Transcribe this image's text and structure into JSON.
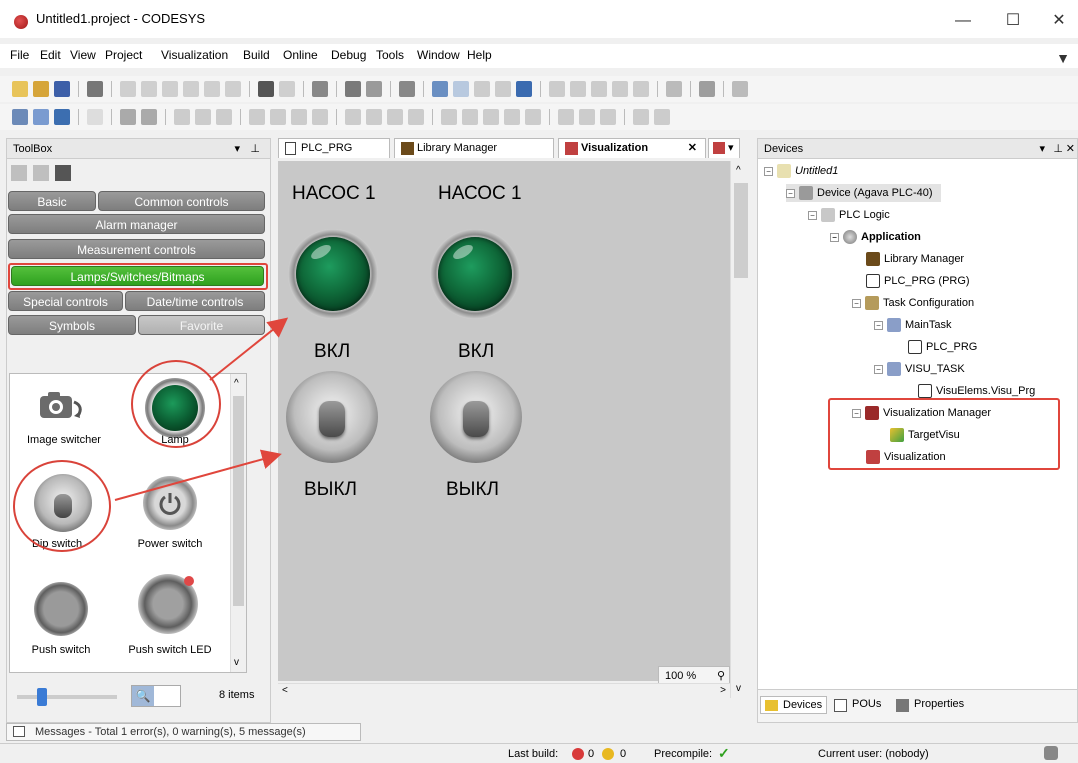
{
  "window": {
    "title": "Untitled1.project - CODESYS",
    "minimize": "—",
    "maximize": "☐",
    "close": "✕"
  },
  "menu": [
    "File",
    "Edit",
    "View",
    "Project",
    "Visualization",
    "Build",
    "Online",
    "Debug",
    "Tools",
    "Window",
    "Help"
  ],
  "toolbox": {
    "title": "ToolBox",
    "categories": {
      "basic": "Basic",
      "common": "Common controls",
      "alarm": "Alarm manager",
      "measurement": "Measurement controls",
      "lamps": "Lamps/Switches/Bitmaps",
      "special": "Special controls",
      "datetime": "Date/time controls",
      "symbols": "Symbols",
      "favorite": "Favorite"
    },
    "items": [
      "Image switcher",
      "Lamp",
      "Dip switch",
      "Power switch",
      "Push switch",
      "Push switch LED"
    ],
    "count": "8 items"
  },
  "editor": {
    "tabs": [
      "PLC_PRG",
      "Library Manager",
      "Visualization"
    ],
    "labels": {
      "pump1": "НАСОС 1",
      "pump2": "НАСОС 1",
      "on1": "ВКЛ",
      "on2": "ВКЛ",
      "off1": "ВЫКЛ",
      "off2": "ВЫКЛ"
    },
    "zoom": "100 %"
  },
  "devices": {
    "title": "Devices",
    "tree": [
      "Untitled1",
      "Device (Agava PLC-40)",
      "PLC Logic",
      "Application",
      "Library Manager",
      "PLC_PRG (PRG)",
      "Task Configuration",
      "MainTask",
      "PLC_PRG",
      "VISU_TASK",
      "VisuElems.Visu_Prg",
      "Visualization Manager",
      "TargetVisu",
      "Visualization"
    ],
    "bottom_tabs": [
      "Devices",
      "POUs",
      "Properties"
    ]
  },
  "messages": "Messages - Total 1 error(s), 0 warning(s), 5 message(s)",
  "status": {
    "last_build": "Last build:",
    "errors": "0",
    "warnings": "0",
    "precompile": "Precompile:",
    "user": "Current user: (nobody)"
  }
}
